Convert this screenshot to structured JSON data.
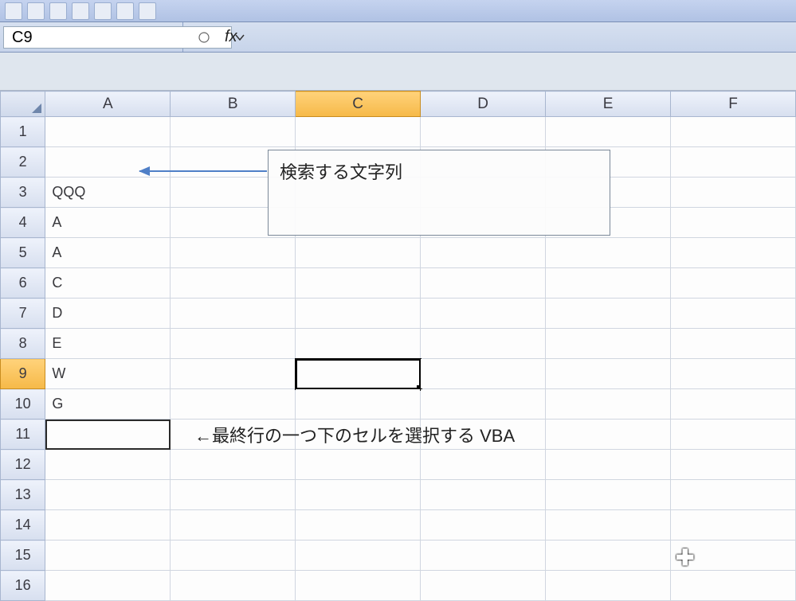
{
  "namebox": {
    "value": "C9"
  },
  "formula_bar": {
    "fx_label": "fx",
    "value": ""
  },
  "columns": [
    "A",
    "B",
    "C",
    "D",
    "E",
    "F"
  ],
  "active_column": "C",
  "active_row": 9,
  "rows": [
    {
      "n": 1,
      "A": ""
    },
    {
      "n": 2,
      "A": ""
    },
    {
      "n": 3,
      "A": "QQQ"
    },
    {
      "n": 4,
      "A": "A"
    },
    {
      "n": 5,
      "A": "A"
    },
    {
      "n": 6,
      "A": "C"
    },
    {
      "n": 7,
      "A": "D"
    },
    {
      "n": 8,
      "A": "E"
    },
    {
      "n": 9,
      "A": "W"
    },
    {
      "n": 10,
      "A": "G"
    },
    {
      "n": 11,
      "A": ""
    },
    {
      "n": 12,
      "A": ""
    },
    {
      "n": 13,
      "A": ""
    },
    {
      "n": 14,
      "A": ""
    },
    {
      "n": 15,
      "A": ""
    },
    {
      "n": 16,
      "A": ""
    }
  ],
  "annotations": {
    "search_label": "検索する文字列",
    "row11_note": "←最終行の一つ下のセルを選択する  VBA"
  }
}
